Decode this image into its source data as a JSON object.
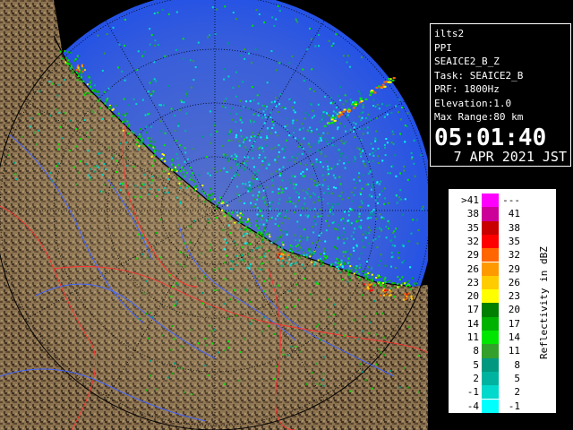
{
  "info": {
    "station": "ilts2",
    "product": "PPI",
    "dataset": "SEAICE2_B_Z",
    "task": "Task: SEAICE2_B",
    "prf": "PRF: 1800Hz",
    "elevation": "Elevation:1.0",
    "max_range": "Max Range:80 km",
    "time": "05:01:40",
    "date": "7 APR 2021 JST"
  },
  "legend": {
    "title": "Reflectivity in dBZ",
    "rows": [
      {
        "lo": ">41",
        "hi": "---",
        "color": "#ff00ff"
      },
      {
        "lo": "38",
        "hi": "41",
        "color": "#cc0099"
      },
      {
        "lo": "35",
        "hi": "38",
        "color": "#c80000"
      },
      {
        "lo": "32",
        "hi": "35",
        "color": "#ff0000"
      },
      {
        "lo": "29",
        "hi": "32",
        "color": "#ff6600"
      },
      {
        "lo": "26",
        "hi": "29",
        "color": "#ff9900"
      },
      {
        "lo": "23",
        "hi": "26",
        "color": "#ffcc00"
      },
      {
        "lo": "20",
        "hi": "23",
        "color": "#ffff00"
      },
      {
        "lo": "17",
        "hi": "20",
        "color": "#007f00"
      },
      {
        "lo": "14",
        "hi": "17",
        "color": "#00b200"
      },
      {
        "lo": "11",
        "hi": "14",
        "color": "#00e600"
      },
      {
        "lo": "8",
        "hi": "11",
        "color": "#33a02c"
      },
      {
        "lo": "5",
        "hi": "8",
        "color": "#009980"
      },
      {
        "lo": "2",
        "hi": "5",
        "color": "#00b3a0"
      },
      {
        "lo": "-1",
        "hi": "2",
        "color": "#00d9cc"
      },
      {
        "lo": "-4",
        "hi": "-1",
        "color": "#00ffff"
      }
    ]
  },
  "colors": {
    "background": "#000000",
    "radar_circle": "#1040e0",
    "land": "#8c7350",
    "rivers": "#4466ff",
    "boundaries": "#ff3333"
  }
}
